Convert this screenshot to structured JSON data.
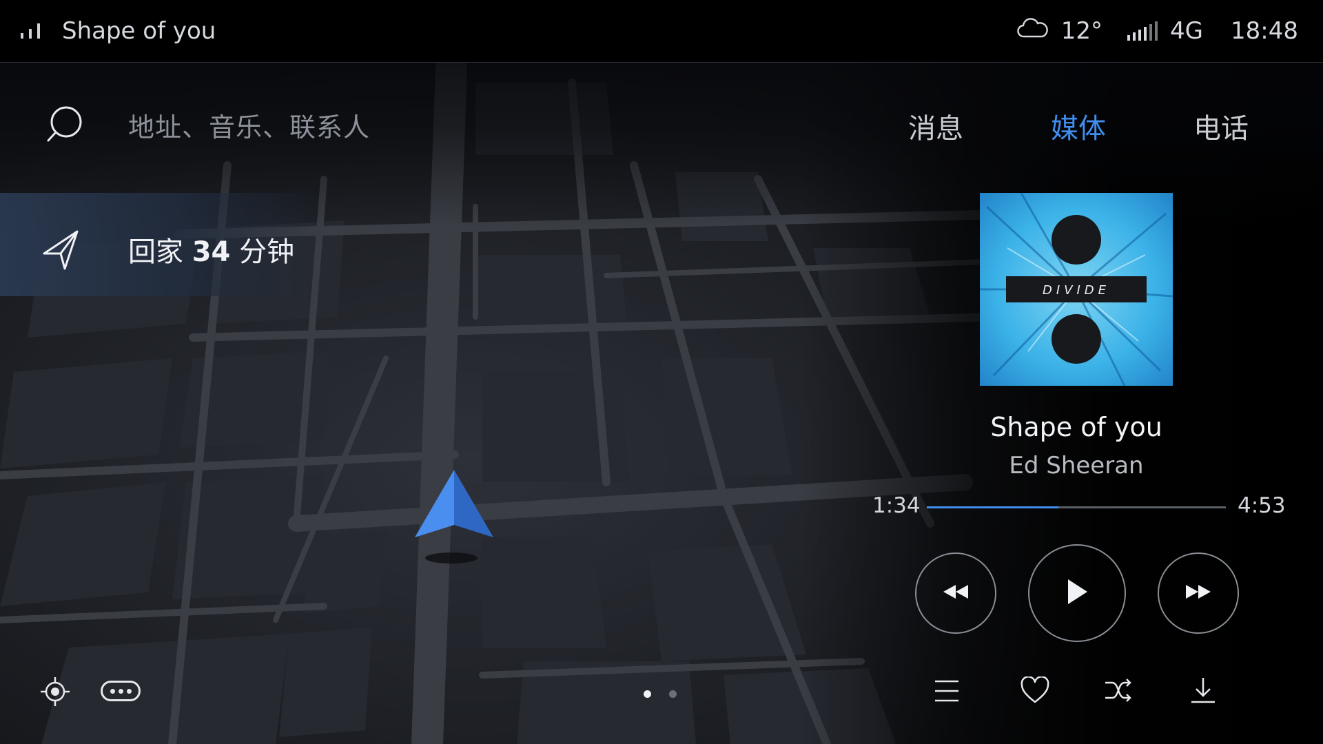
{
  "status_bar": {
    "now_playing": "Shape of you",
    "weather_icon": "cloud-icon",
    "temperature": "12°",
    "network": "4G",
    "time": "18:48"
  },
  "search": {
    "placeholder": "地址、音乐、联系人"
  },
  "tabs": [
    {
      "label": "消息",
      "active": false
    },
    {
      "label": "媒体",
      "active": true
    },
    {
      "label": "电话",
      "active": false
    }
  ],
  "navigation": {
    "prefix": "回家",
    "minutes": "34",
    "unit": "分钟"
  },
  "media": {
    "album_text": "DIVIDE",
    "title": "Shape of you",
    "artist": "Ed Sheeran",
    "elapsed": "1:34",
    "duration": "4:53",
    "progress_fraction": 0.44
  },
  "pager": {
    "pages": 2,
    "current": 0
  },
  "colors": {
    "accent": "#3f8ef0",
    "vehicle": "#3a7fe0"
  }
}
